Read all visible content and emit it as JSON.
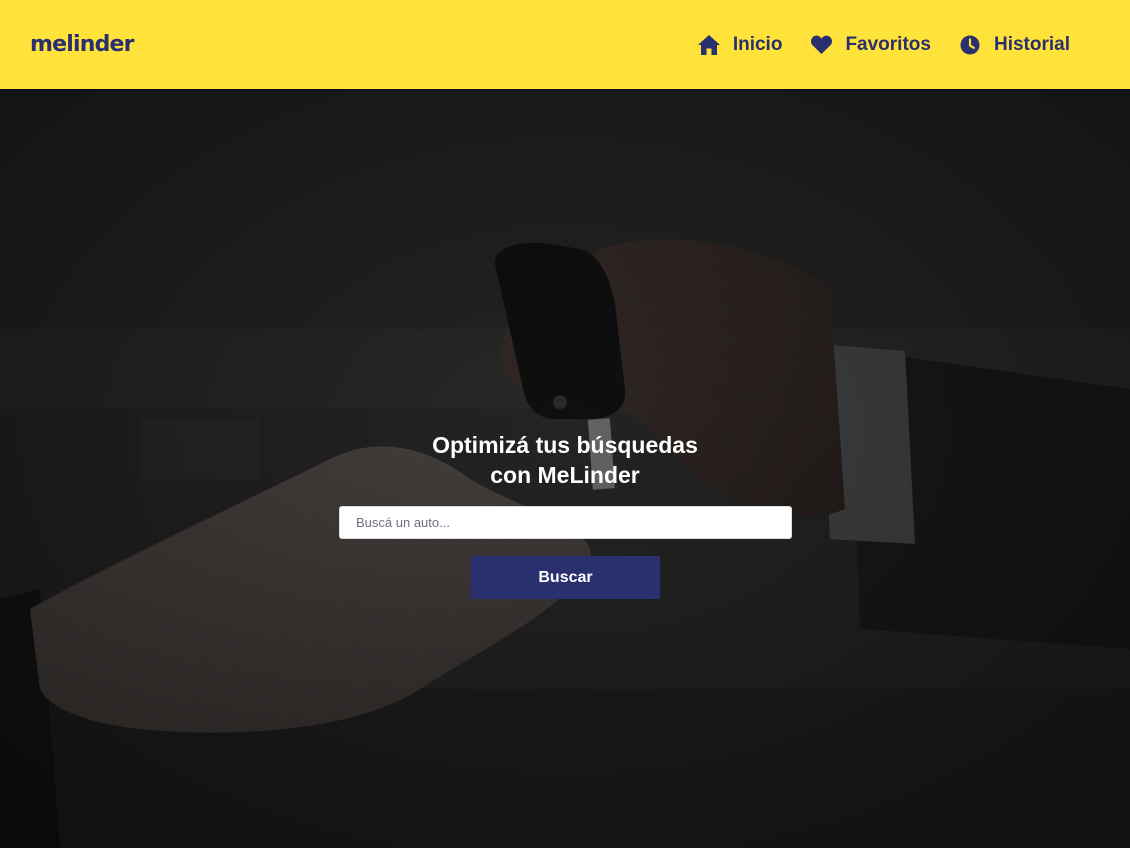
{
  "header": {
    "logo_text": "melinder",
    "nav": [
      {
        "label": "Inicio",
        "icon": "home-icon"
      },
      {
        "label": "Favoritos",
        "icon": "heart-icon"
      },
      {
        "label": "Historial",
        "icon": "clock-icon"
      }
    ],
    "background_color": "#ffe23a",
    "accent_color": "#2a2f6e"
  },
  "hero": {
    "headline_line1": "Optimizá tus búsquedas",
    "headline_prefix": "con ",
    "headline_brand": "MeLinder",
    "search": {
      "placeholder": "Buscá un auto...",
      "value": ""
    },
    "button_label": "Buscar"
  }
}
